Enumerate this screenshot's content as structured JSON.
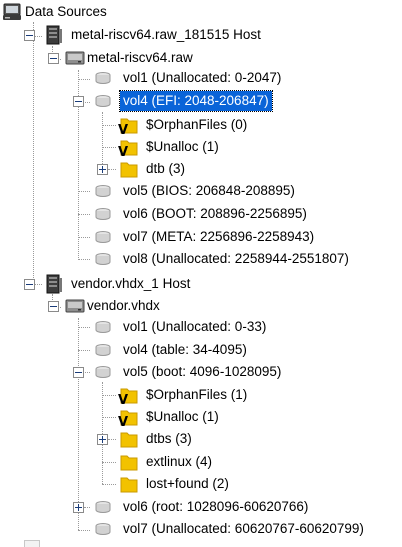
{
  "tree": {
    "root": {
      "label": "Data Sources",
      "icon": "data-sources-icon"
    },
    "hosts": [
      {
        "label": "metal-riscv64.raw_181515 Host",
        "image": {
          "label": "metal-riscv64.raw",
          "volumes": [
            {
              "label": "vol1 (Unallocated: 0-2047)"
            },
            {
              "label": "vol4 (EFI: 2048-206847)",
              "selected": true,
              "children": [
                {
                  "label": "$OrphanFiles (0)"
                },
                {
                  "label": "$Unalloc (1)"
                },
                {
                  "label": "dtb (3)"
                }
              ]
            },
            {
              "label": "vol5 (BIOS: 206848-208895)"
            },
            {
              "label": "vol6 (BOOT: 208896-2256895)"
            },
            {
              "label": "vol7 (META: 2256896-2258943)"
            },
            {
              "label": "vol8 (Unallocated: 2258944-2551807)"
            }
          ]
        }
      },
      {
        "label": "vendor.vhdx_1 Host",
        "image": {
          "label": "vendor.vhdx",
          "volumes": [
            {
              "label": "vol1 (Unallocated: 0-33)"
            },
            {
              "label": "vol4 (table: 34-4095)"
            },
            {
              "label": "vol5 (boot: 4096-1028095)",
              "children": [
                {
                  "label": "$OrphanFiles (1)"
                },
                {
                  "label": "$Unalloc (1)"
                },
                {
                  "label": "dtbs (3)"
                },
                {
                  "label": "extlinux (4)"
                },
                {
                  "label": "lost+found (2)"
                }
              ]
            },
            {
              "label": "vol6 (root: 1028096-60620766)"
            },
            {
              "label": "vol7 (Unallocated: 60620767-60620799)"
            }
          ]
        }
      }
    ]
  },
  "colors": {
    "selection_bg": "#0a64d8",
    "folder": "#f2c200",
    "folder_dark": "#c99a00",
    "connector": "#9a9a9a"
  }
}
